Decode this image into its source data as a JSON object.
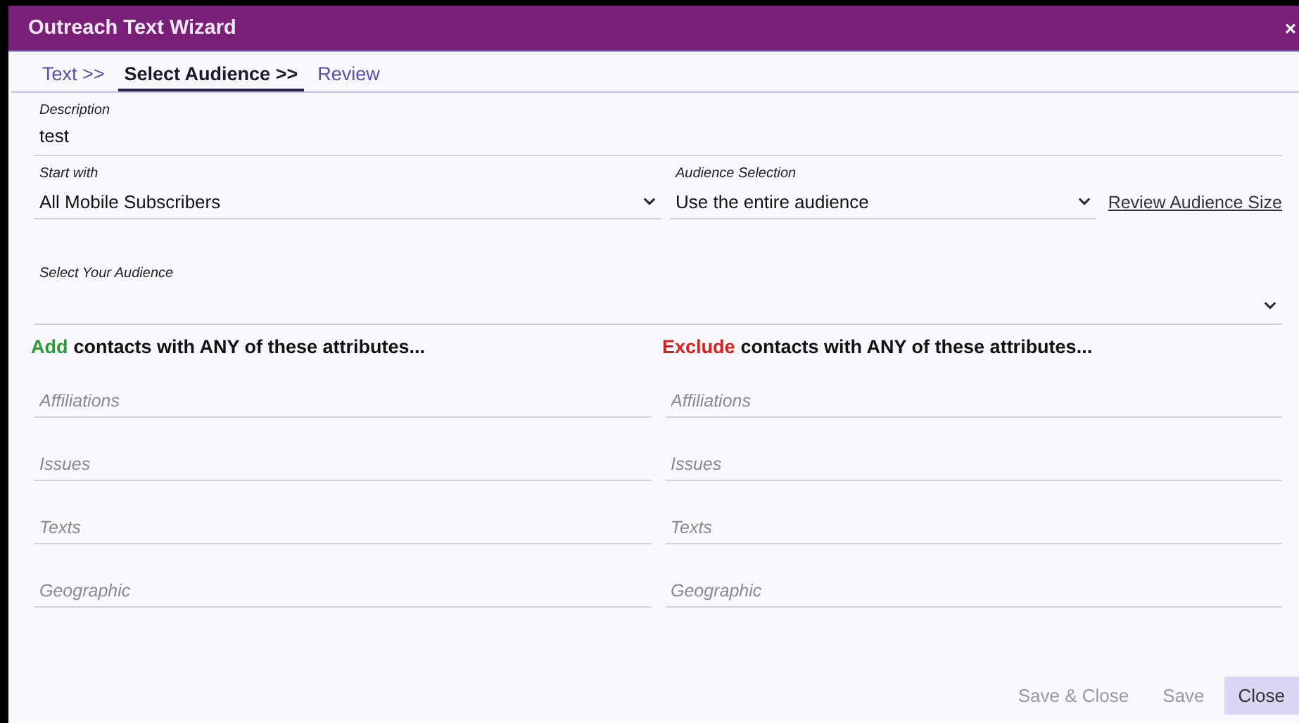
{
  "window": {
    "title": "Outreach Text Wizard",
    "close": "×"
  },
  "tabs": [
    {
      "label": "Text >>",
      "selected": false
    },
    {
      "label": "Select Audience >>",
      "selected": true
    },
    {
      "label": "Review",
      "selected": false
    }
  ],
  "description": {
    "label": "Description",
    "value": "test"
  },
  "start_with": {
    "label": "Start with",
    "value": "All Mobile Subscribers"
  },
  "audience_selection": {
    "label": "Audience Selection",
    "value": "Use the entire audience",
    "link": "Review Audience Size"
  },
  "select_audience": {
    "label": "Select Your Audience"
  },
  "columns": [
    {
      "verb": "Add",
      "color": "#2a9a3a",
      "heading": "contacts with ANY of these attributes...",
      "fields": [
        {
          "placeholder": "Affiliations"
        },
        {
          "placeholder": "Issues"
        },
        {
          "placeholder": "Texts"
        },
        {
          "placeholder": "Geographic"
        }
      ]
    },
    {
      "verb": "Exclude",
      "color": "#dd1c1c",
      "heading": "contacts with ANY of these attributes...",
      "fields": [
        {
          "placeholder": "Affiliations"
        },
        {
          "placeholder": "Issues"
        },
        {
          "placeholder": "Texts"
        },
        {
          "placeholder": "Geographic"
        }
      ]
    }
  ],
  "buttons": [
    {
      "label": "Save & Close",
      "disabled": true
    },
    {
      "label": "Save",
      "disabled": true
    },
    {
      "label": "Close",
      "disabled": false
    }
  ]
}
